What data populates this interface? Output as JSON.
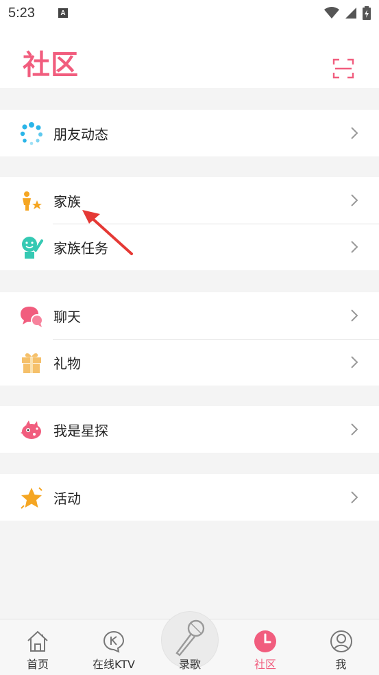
{
  "status_bar": {
    "time": "5:23",
    "notification_icon": "A"
  },
  "header": {
    "title": "社区",
    "scan_icon": "scan-icon"
  },
  "groups": [
    {
      "items": [
        {
          "label": "朋友动态",
          "icon": "friends-feed-icon",
          "color": "#2bb5e8"
        }
      ]
    },
    {
      "items": [
        {
          "label": "家族",
          "icon": "family-icon",
          "color": "#f5a623"
        },
        {
          "label": "家族任务",
          "icon": "family-task-icon",
          "color": "#35c9b3"
        }
      ]
    },
    {
      "items": [
        {
          "label": "聊天",
          "icon": "chat-icon",
          "color": "#f15d7e"
        },
        {
          "label": "礼物",
          "icon": "gift-icon",
          "color": "#f5c06a"
        }
      ]
    },
    {
      "items": [
        {
          "label": "我是星探",
          "icon": "talent-scout-icon",
          "color": "#f15d7e"
        }
      ]
    },
    {
      "items": [
        {
          "label": "活动",
          "icon": "star-icon",
          "color": "#f5a623"
        }
      ]
    }
  ],
  "bottom_nav": {
    "items": [
      {
        "label": "首页",
        "icon": "home-icon"
      },
      {
        "label": "在线KTV",
        "icon": "ktv-icon"
      },
      {
        "label": "录歌",
        "icon": "microphone-icon"
      },
      {
        "label": "社区",
        "icon": "community-clock-icon",
        "active": true
      },
      {
        "label": "我",
        "icon": "profile-icon"
      }
    ]
  },
  "colors": {
    "accent": "#f15d7e",
    "background": "#f4f4f4",
    "arrow": "#e53935"
  }
}
